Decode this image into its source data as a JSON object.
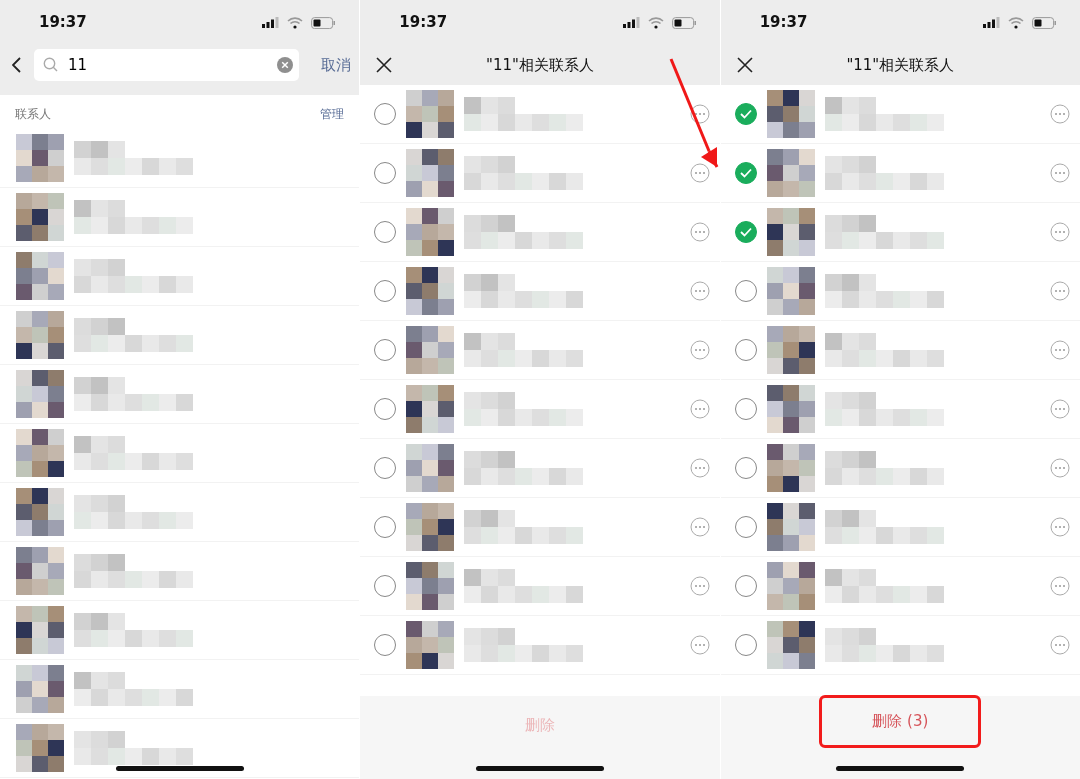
{
  "screens": [
    {
      "kind": "search",
      "time": "19:37",
      "search": {
        "value": "11"
      },
      "cancel": "取消",
      "section": {
        "title": "联系人",
        "action": "管理"
      }
    },
    {
      "kind": "select",
      "time": "19:37",
      "title": "\"11\"相关联系人",
      "rows": [
        {
          "selected": false
        },
        {
          "selected": false
        },
        {
          "selected": false
        },
        {
          "selected": false
        },
        {
          "selected": false
        },
        {
          "selected": false
        },
        {
          "selected": false
        },
        {
          "selected": false
        },
        {
          "selected": false
        },
        {
          "selected": false
        }
      ],
      "delete_button": {
        "label": "删除",
        "disabled": true,
        "highlighted": false
      }
    },
    {
      "kind": "select",
      "time": "19:37",
      "title": "\"11\"相关联系人",
      "rows": [
        {
          "selected": true
        },
        {
          "selected": true
        },
        {
          "selected": true
        },
        {
          "selected": false
        },
        {
          "selected": false
        },
        {
          "selected": false
        },
        {
          "selected": false
        },
        {
          "selected": false
        },
        {
          "selected": false
        },
        {
          "selected": false
        }
      ],
      "delete_button": {
        "label": "删除 (3)",
        "disabled": false,
        "highlighted": true
      }
    }
  ],
  "annotation_arrow": true
}
